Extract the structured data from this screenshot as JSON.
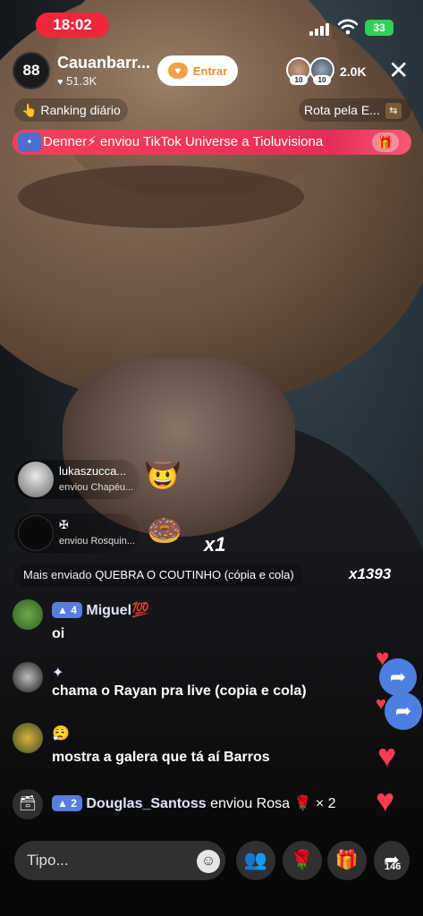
{
  "status": {
    "time": "18:02",
    "battery": "33"
  },
  "host": {
    "name": "Cauanbarr...",
    "likes": "51.3K",
    "avatar_number": "88",
    "join_label": "Entrar"
  },
  "viewers": {
    "count": "2.0K",
    "badge1": "10",
    "badge2": "10"
  },
  "ranking": {
    "label": "Ranking diário",
    "route_label": "Rota pela E..."
  },
  "gift_banner": {
    "text": "Denner⚡ enviou TikTok Universe a Tioluvisiona"
  },
  "combos": [
    {
      "name": "lukaszucca...",
      "sub": "enviou Chapéu...",
      "multiplier": ""
    },
    {
      "name": "✠",
      "sub": "enviou Rosquin...",
      "multiplier": "x1"
    }
  ],
  "most_sent": {
    "prefix": "Mais enviado",
    "title": "QUEBRA O COUTINHO (cópia e cola)",
    "count": "x1393"
  },
  "chat": [
    {
      "level": "4",
      "user": "Miguel💯",
      "message": "oi"
    },
    {
      "user": "✦",
      "message": "chama o Rayan pra live (copia e cola)"
    },
    {
      "user": "😮‍💨",
      "message": "mostra a galera que tá aí Barros"
    }
  ],
  "gift_line": {
    "level": "2",
    "user": "Douglas_Santoss",
    "text": "enviou Rosa 🌹 × 2"
  },
  "bottom": {
    "placeholder": "Tipo...",
    "share_count": "146"
  },
  "colors": {
    "accent": "#f0263a",
    "banner": "#f5285a",
    "level_badge": "#5a7cdc",
    "heart": "#ff3b53"
  }
}
